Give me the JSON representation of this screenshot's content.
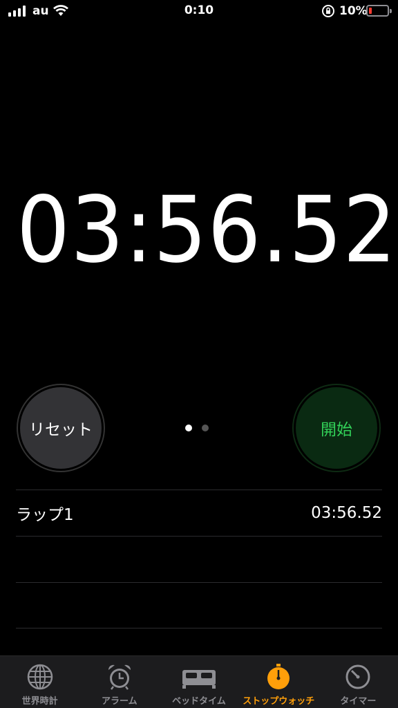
{
  "status_bar": {
    "carrier": "au",
    "time": "0:10",
    "battery_percent": "10%"
  },
  "stopwatch": {
    "time": "03:56.52"
  },
  "buttons": {
    "reset_label": "リセット",
    "start_label": "開始"
  },
  "page_indicator": {
    "count": 2,
    "active": 0
  },
  "laps": [
    {
      "label": "ラップ1",
      "time": "03:56.52"
    }
  ],
  "tab_bar": {
    "tabs": [
      {
        "label": "世界時計",
        "icon": "globe-icon",
        "active": false
      },
      {
        "label": "アラーム",
        "icon": "alarm-clock-icon",
        "active": false
      },
      {
        "label": "ベッドタイム",
        "icon": "bed-icon",
        "active": false
      },
      {
        "label": "ストップウォッチ",
        "icon": "stopwatch-icon",
        "active": true
      },
      {
        "label": "タイマー",
        "icon": "timer-icon",
        "active": false
      }
    ]
  },
  "colors": {
    "accent": "#ff9f0a",
    "start_text": "#32d158",
    "battery_low": "#ff3b30"
  }
}
